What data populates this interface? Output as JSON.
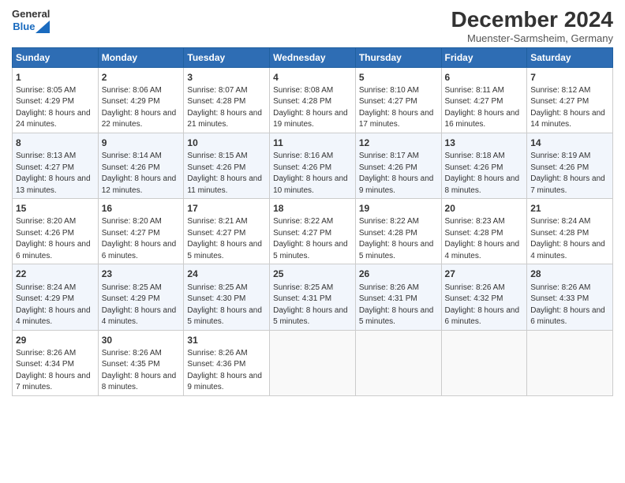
{
  "header": {
    "logo_general": "General",
    "logo_blue": "Blue",
    "title": "December 2024",
    "subtitle": "Muenster-Sarmsheim, Germany"
  },
  "calendar": {
    "days_of_week": [
      "Sunday",
      "Monday",
      "Tuesday",
      "Wednesday",
      "Thursday",
      "Friday",
      "Saturday"
    ],
    "weeks": [
      [
        {
          "day": "1",
          "sunrise": "8:05 AM",
          "sunset": "4:29 PM",
          "daylight": "8 hours and 24 minutes."
        },
        {
          "day": "2",
          "sunrise": "8:06 AM",
          "sunset": "4:29 PM",
          "daylight": "8 hours and 22 minutes."
        },
        {
          "day": "3",
          "sunrise": "8:07 AM",
          "sunset": "4:28 PM",
          "daylight": "8 hours and 21 minutes."
        },
        {
          "day": "4",
          "sunrise": "8:08 AM",
          "sunset": "4:28 PM",
          "daylight": "8 hours and 19 minutes."
        },
        {
          "day": "5",
          "sunrise": "8:10 AM",
          "sunset": "4:27 PM",
          "daylight": "8 hours and 17 minutes."
        },
        {
          "day": "6",
          "sunrise": "8:11 AM",
          "sunset": "4:27 PM",
          "daylight": "8 hours and 16 minutes."
        },
        {
          "day": "7",
          "sunrise": "8:12 AM",
          "sunset": "4:27 PM",
          "daylight": "8 hours and 14 minutes."
        }
      ],
      [
        {
          "day": "8",
          "sunrise": "8:13 AM",
          "sunset": "4:27 PM",
          "daylight": "8 hours and 13 minutes."
        },
        {
          "day": "9",
          "sunrise": "8:14 AM",
          "sunset": "4:26 PM",
          "daylight": "8 hours and 12 minutes."
        },
        {
          "day": "10",
          "sunrise": "8:15 AM",
          "sunset": "4:26 PM",
          "daylight": "8 hours and 11 minutes."
        },
        {
          "day": "11",
          "sunrise": "8:16 AM",
          "sunset": "4:26 PM",
          "daylight": "8 hours and 10 minutes."
        },
        {
          "day": "12",
          "sunrise": "8:17 AM",
          "sunset": "4:26 PM",
          "daylight": "8 hours and 9 minutes."
        },
        {
          "day": "13",
          "sunrise": "8:18 AM",
          "sunset": "4:26 PM",
          "daylight": "8 hours and 8 minutes."
        },
        {
          "day": "14",
          "sunrise": "8:19 AM",
          "sunset": "4:26 PM",
          "daylight": "8 hours and 7 minutes."
        }
      ],
      [
        {
          "day": "15",
          "sunrise": "8:20 AM",
          "sunset": "4:26 PM",
          "daylight": "8 hours and 6 minutes."
        },
        {
          "day": "16",
          "sunrise": "8:20 AM",
          "sunset": "4:27 PM",
          "daylight": "8 hours and 6 minutes."
        },
        {
          "day": "17",
          "sunrise": "8:21 AM",
          "sunset": "4:27 PM",
          "daylight": "8 hours and 5 minutes."
        },
        {
          "day": "18",
          "sunrise": "8:22 AM",
          "sunset": "4:27 PM",
          "daylight": "8 hours and 5 minutes."
        },
        {
          "day": "19",
          "sunrise": "8:22 AM",
          "sunset": "4:28 PM",
          "daylight": "8 hours and 5 minutes."
        },
        {
          "day": "20",
          "sunrise": "8:23 AM",
          "sunset": "4:28 PM",
          "daylight": "8 hours and 4 minutes."
        },
        {
          "day": "21",
          "sunrise": "8:24 AM",
          "sunset": "4:28 PM",
          "daylight": "8 hours and 4 minutes."
        }
      ],
      [
        {
          "day": "22",
          "sunrise": "8:24 AM",
          "sunset": "4:29 PM",
          "daylight": "8 hours and 4 minutes."
        },
        {
          "day": "23",
          "sunrise": "8:25 AM",
          "sunset": "4:29 PM",
          "daylight": "8 hours and 4 minutes."
        },
        {
          "day": "24",
          "sunrise": "8:25 AM",
          "sunset": "4:30 PM",
          "daylight": "8 hours and 5 minutes."
        },
        {
          "day": "25",
          "sunrise": "8:25 AM",
          "sunset": "4:31 PM",
          "daylight": "8 hours and 5 minutes."
        },
        {
          "day": "26",
          "sunrise": "8:26 AM",
          "sunset": "4:31 PM",
          "daylight": "8 hours and 5 minutes."
        },
        {
          "day": "27",
          "sunrise": "8:26 AM",
          "sunset": "4:32 PM",
          "daylight": "8 hours and 6 minutes."
        },
        {
          "day": "28",
          "sunrise": "8:26 AM",
          "sunset": "4:33 PM",
          "daylight": "8 hours and 6 minutes."
        }
      ],
      [
        {
          "day": "29",
          "sunrise": "8:26 AM",
          "sunset": "4:34 PM",
          "daylight": "8 hours and 7 minutes."
        },
        {
          "day": "30",
          "sunrise": "8:26 AM",
          "sunset": "4:35 PM",
          "daylight": "8 hours and 8 minutes."
        },
        {
          "day": "31",
          "sunrise": "8:26 AM",
          "sunset": "4:36 PM",
          "daylight": "8 hours and 9 minutes."
        },
        null,
        null,
        null,
        null
      ]
    ]
  }
}
